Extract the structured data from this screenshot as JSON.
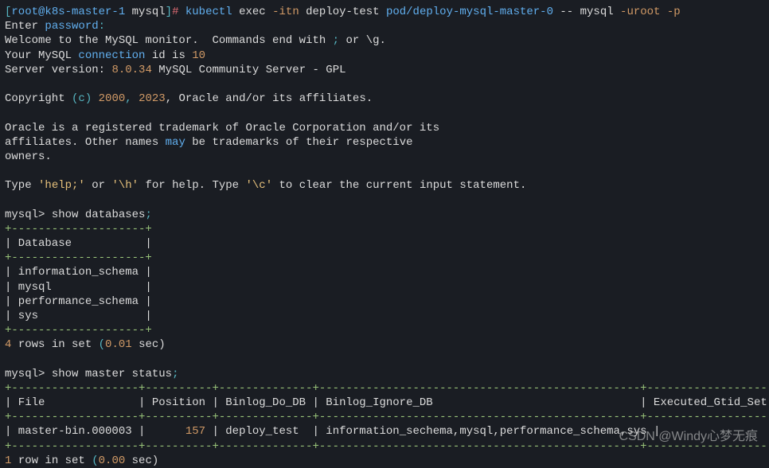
{
  "prompt": {
    "user": "root@k8s-master-1",
    "dir": "mysql",
    "hash": "#",
    "cmd": "kubectl",
    "args1": "exec",
    "flag1": "-itn",
    "args2": "deploy-test",
    "args3": "pod/deploy-mysql-master-0",
    "dashdash": "--",
    "mysql": "mysql",
    "flag2": "-uroot -p"
  },
  "intro": {
    "enter": "Enter",
    "password": "password",
    "colon": ":",
    "welcome": "Welcome to the MySQL monitor.  Commands end with",
    "semicolon": ";",
    "or": "or",
    "g": "\\g",
    "period": ".",
    "yourmysql": "Your MySQL",
    "connection": "connection",
    "idis": "id is",
    "connid": "10",
    "serverversion": "Server version:",
    "version": "8.0.34",
    "serverdesc": "MySQL Community Server - GPL"
  },
  "copyright": {
    "copyright": "Copyright",
    "c": "(c)",
    "y1": "2000",
    "comma": ",",
    "y2": "2023",
    "rest": ", Oracle and/or its affiliates."
  },
  "trademark": {
    "line1": "Oracle is a registered trademark of Oracle Corporation and/or its",
    "line2a": "affiliates. Other names",
    "may": "may",
    "line2b": "be trademarks of their respective",
    "line3": "owners."
  },
  "help": {
    "type": "Type",
    "help": "'help;'",
    "or": "or",
    "h": "'\\h'",
    "forhelp": "for help. Type",
    "c": "'\\c'",
    "toclear": "to clear the current input statement."
  },
  "query1": {
    "prompt": "mysql>",
    "cmd": "show databases",
    "semi": ";"
  },
  "table1": {
    "border": "+--------------------+",
    "header": "| Database           |",
    "r1": "| information_schema |",
    "r2": "| mysql              |",
    "r3": "| performance_schema |",
    "r4": "| sys                |"
  },
  "result1": {
    "count": "4",
    "rowsin": "rows in set",
    "paren1": "(",
    "time": "0.01",
    "sec": "sec)"
  },
  "query2": {
    "prompt": "mysql>",
    "cmd": "show master status",
    "semi": ";"
  },
  "table2": {
    "border": "+-------------------+----------+--------------+------------------------------------------------+-------------------+",
    "header": "| File              | Position | Binlog_Do_DB | Binlog_Ignore_DB                               | Executed_Gtid_Set |",
    "row_p1": "| master-bin.000003 |      ",
    "row_pos": "157",
    "row_p2": " | deploy_test  | information_sechema,mysql,performance_schema,sys |                   |"
  },
  "result2": {
    "count": "1",
    "rowsin": "row in set",
    "paren1": "(",
    "time": "0.00",
    "sec": "sec)"
  },
  "watermark": "CSDN @Windy心梦无痕"
}
